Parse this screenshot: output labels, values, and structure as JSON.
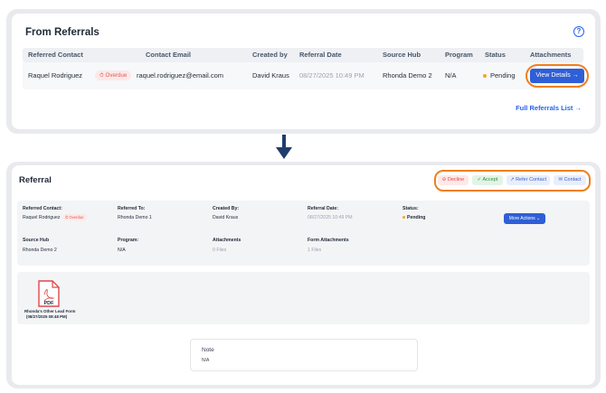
{
  "referrals_list": {
    "title": "From Referrals",
    "headers": [
      "Referred Contact",
      "Contact Email",
      "Created by",
      "Referral Date",
      "Source Hub",
      "Program",
      "Status",
      "Attachments"
    ],
    "row": {
      "contact": "Raquel Rodriguez",
      "badge": "⏱ Overdue",
      "email": "raquel.rodriguez@email.com",
      "created_by": "David Kraus",
      "date": "08/27/2025 10:49 PM",
      "hub": "Rhonda Demo 2",
      "program": "N/A",
      "status": "Pending",
      "view_button": "View Details →"
    },
    "full_link": "Full Referrals List →",
    "help_icon": "?"
  },
  "arrow_icon": "down-arrow",
  "referral_detail": {
    "title": "Referral",
    "actions": {
      "decline": "⊘ Decline",
      "accept": "✓ Accept",
      "refer": "↗ Refer Contact",
      "contact": "✉ Contact"
    },
    "fields": {
      "referred_contact_label": "Referred Contact:",
      "referred_contact_value": "Raquel Rodriguez",
      "referred_contact_badge": "⏱ Overdue",
      "referred_to_label": "Referred To:",
      "referred_to_value": "Rhonda Demo 1",
      "created_by_label": "Created By:",
      "created_by_value": "David Kraus",
      "date_label": "Referral Date:",
      "date_value": "08/27/2025 10:49 PM",
      "status_label": "Status:",
      "status_value": "Pending",
      "more_actions": "More Actions ⌄",
      "source_hub_label": "Source Hub",
      "source_hub_value": "Rhonda Demo 2",
      "program_label": "Program:",
      "program_value": "N/A",
      "attachments_label": "Attachments",
      "attachments_value": "0 Files",
      "form_attachments_label": "Form Attachments",
      "form_attachments_value": "1 Files"
    },
    "file": {
      "icon_text": "PDF",
      "name_line1": "Rhonda's Other Lead Form",
      "name_line2": "(08/27/2025 08:48 PM)"
    },
    "note": {
      "title": "Note",
      "value": "N/A"
    }
  },
  "colors": {
    "accent": "#2f5fd6",
    "highlight_ring": "#f07f1e",
    "overdue": "#e05a5a",
    "pending": "#f5a623",
    "arrow": "#1f3d6b"
  }
}
